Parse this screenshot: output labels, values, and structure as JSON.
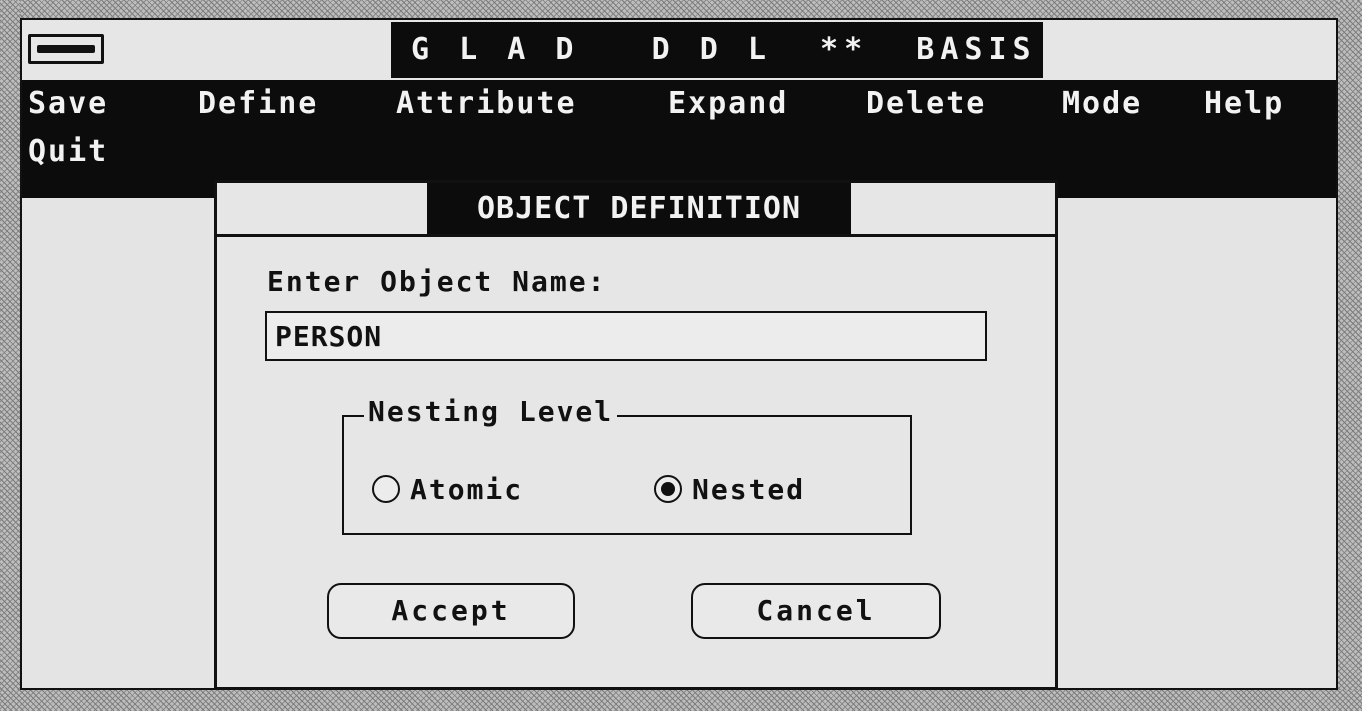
{
  "window": {
    "title": "G L A D   D D L  **  BASIS"
  },
  "menubar": {
    "items": [
      {
        "label": "Save"
      },
      {
        "label": "Define"
      },
      {
        "label": "Attribute"
      },
      {
        "label": "Expand"
      },
      {
        "label": "Delete"
      },
      {
        "label": "Mode"
      },
      {
        "label": "Help"
      },
      {
        "label": "Quit"
      }
    ]
  },
  "dialog": {
    "title": "OBJECT DEFINITION",
    "name_label": "Enter Object Name:",
    "name_value": "PERSON",
    "nesting": {
      "legend": "Nesting Level",
      "options": [
        {
          "label": "Atomic",
          "selected": false
        },
        {
          "label": "Nested",
          "selected": true
        }
      ]
    },
    "accept_label": "Accept",
    "cancel_label": "Cancel"
  },
  "colors": {
    "bar_black": "#0c0c0c",
    "background": "#e6e6e6",
    "text_light": "#f2f2f2"
  }
}
